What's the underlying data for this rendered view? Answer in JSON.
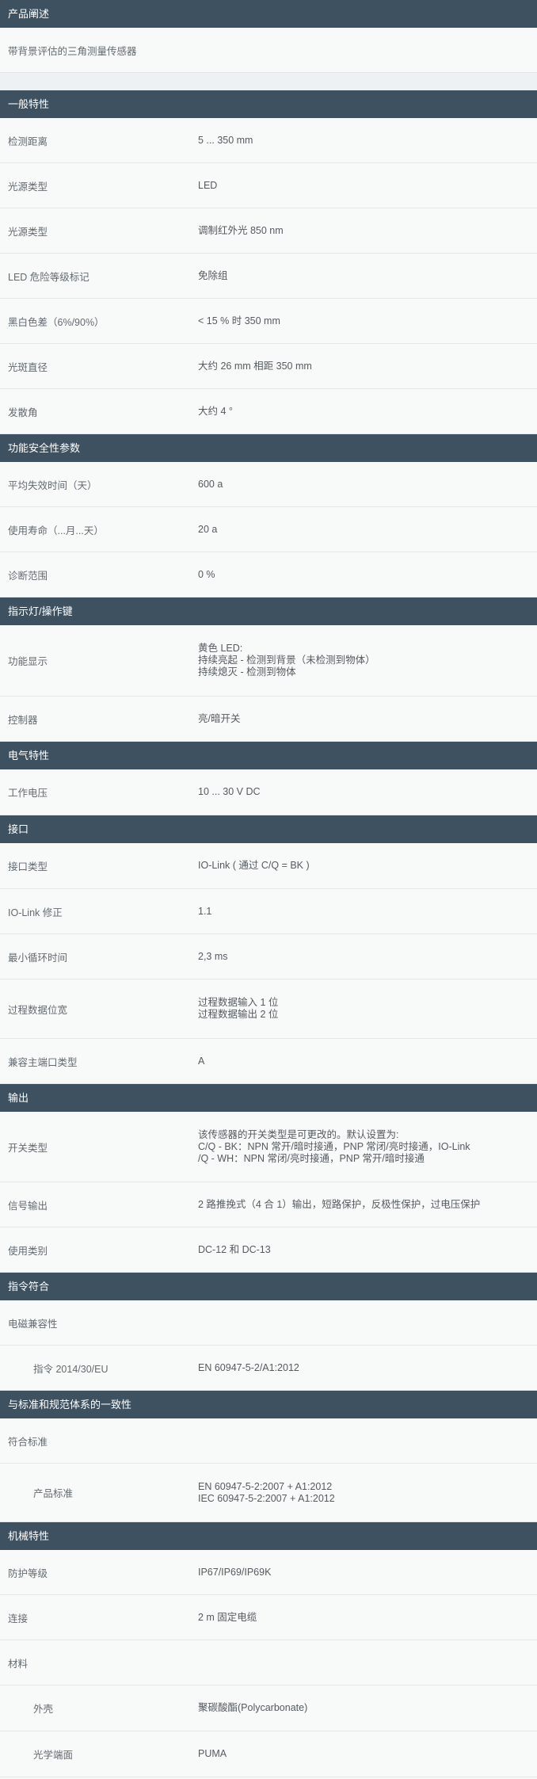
{
  "overview": {
    "header": "产品阐述",
    "description": "带背景评估的三角测量传感器"
  },
  "general": {
    "header": "一般特性",
    "rows": [
      {
        "label": "检测距离",
        "value": "5 ... 350 mm"
      },
      {
        "label": "光源类型",
        "value": "LED"
      },
      {
        "label": "光源类型",
        "value": "调制红外光 850 nm"
      },
      {
        "label": "LED 危险等级标记",
        "value": "免除组"
      },
      {
        "label": "黑白色差（6%/90%）",
        "value": "< 15 % 时 350 mm"
      },
      {
        "label": "光斑直径",
        "value": "大约 26 mm 相距 350 mm"
      },
      {
        "label": "发散角",
        "value": "大约 4 °"
      }
    ]
  },
  "safety": {
    "header": "功能安全性参数",
    "rows": [
      {
        "label": "平均失效时间（天）",
        "value": "600 a"
      },
      {
        "label": "使用寿命（...月...天）",
        "value": "20 a"
      },
      {
        "label": "诊断范围",
        "value": "0 %"
      }
    ]
  },
  "indicators": {
    "header": "指示灯/操作键",
    "function_label": "功能显示",
    "function_lines": [
      "黄色 LED:",
      "持续亮起 - 检测到背景（未检测到物体）",
      "持续熄灭 - 检测到物体"
    ],
    "control_label": "控制器",
    "control_value": "亮/暗开关"
  },
  "electrical": {
    "header": "电气特性",
    "voltage_label": "工作电压",
    "voltage_value": "10 ... 30 V DC"
  },
  "interface": {
    "header": "接口",
    "type_label": "接口类型",
    "type_value": "IO-Link ( 通过 C/Q = BK )",
    "revision_label": "IO-Link 修正",
    "revision_value": "1.1",
    "cycle_label": "最小循环时间",
    "cycle_value": "2,3 ms",
    "width_label": "过程数据位宽",
    "width_lines": [
      "过程数据输入 1 位",
      "过程数据输出 2 位"
    ],
    "port_label": "兼容主端口类型",
    "port_value": "A"
  },
  "output": {
    "header": "输出",
    "switch_label": "开关类型",
    "switch_lines": [
      "该传感器的开关类型是可更改的。默认设置为:",
      "C/Q - BK：NPN 常开/暗时接通，PNP 常闭/亮时接通，IO-Link",
      "/Q - WH：NPN 常闭/亮时接通，PNP 常开/暗时接通"
    ],
    "signal_label": "信号输出",
    "signal_value": "2 路推挽式（4 合 1）输出，短路保护，反极性保护，过电压保护",
    "category_label": "使用类别",
    "category_value": "DC-12 和 DC-13"
  },
  "directives": {
    "header": "指令符合",
    "emc_label": "电磁兼容性",
    "directive_label": "指令 2014/30/EU",
    "directive_value": "EN 60947-5-2/A1:2012"
  },
  "standards": {
    "header": "与标准和规范体系的一致性",
    "conform_label": "符合标准",
    "product_label": "产品标准",
    "product_lines": [
      "EN 60947-5-2:2007 + A1:2012",
      "IEC 60947-5-2:2007 + A1:2012"
    ]
  },
  "mechanical": {
    "header": "机械特性",
    "protection_label": "防护等级",
    "protection_value": "IP67/IP69/IP69K",
    "connection_label": "连接",
    "connection_value": "2 m 固定电缆",
    "material_label": "材料",
    "housing_label": "外壳",
    "housing_value": "聚碳酸酯(Polycarbonate)",
    "optical_label": "光学端面",
    "optical_value": "PUMA"
  }
}
